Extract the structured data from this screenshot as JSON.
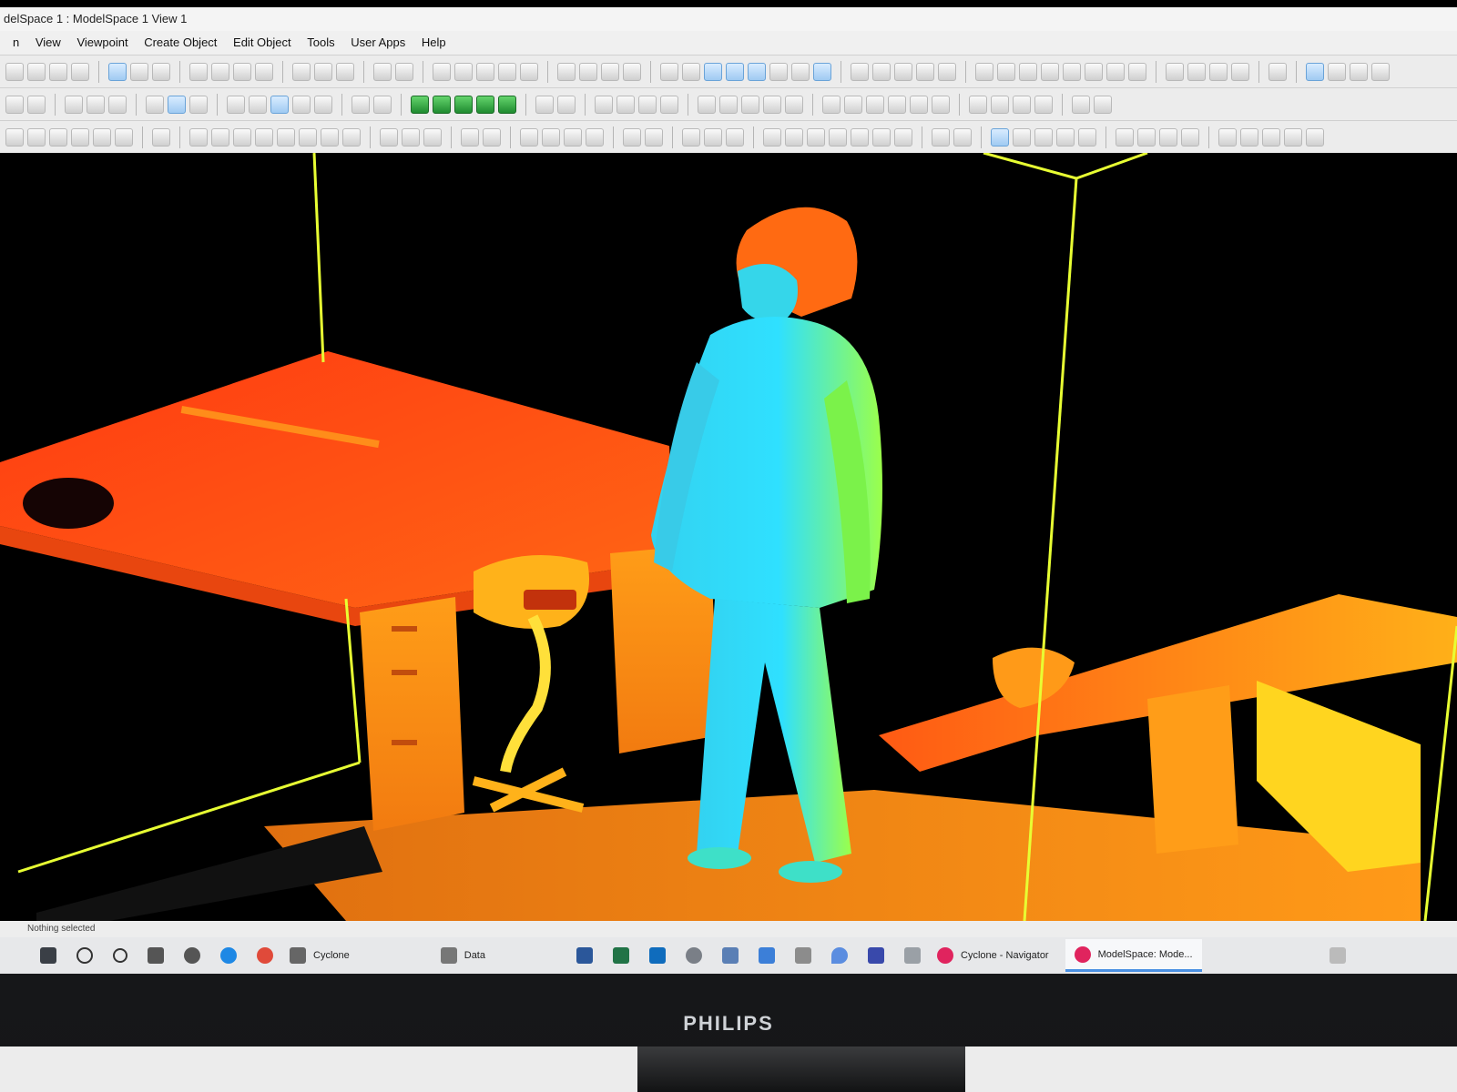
{
  "window": {
    "title": "delSpace 1 : ModelSpace 1 View 1"
  },
  "menu": [
    "n",
    "View",
    "Viewpoint",
    "Create Object",
    "Edit Object",
    "Tools",
    "User Apps",
    "Help"
  ],
  "status": {
    "text": "Nothing selected"
  },
  "taskbar": {
    "items": [
      {
        "label": "Cyclone",
        "icon": "cyclone-icon"
      },
      {
        "label": "Data",
        "icon": "folder-icon"
      },
      {
        "label": "Cyclone - Navigator",
        "icon": "cyclone-navigator-icon"
      },
      {
        "label": "ModelSpace: Mode...",
        "icon": "cyclone-modelspace-icon"
      }
    ]
  },
  "monitor": {
    "brand": "PHILIPS"
  },
  "colors": {
    "background": "#000000",
    "bbox": "#e8ff33",
    "desk_red": "#ff3a10",
    "desk_orange": "#ff9b10",
    "person_cyan": "#2fd0f0",
    "person_green": "#8cff4a"
  }
}
